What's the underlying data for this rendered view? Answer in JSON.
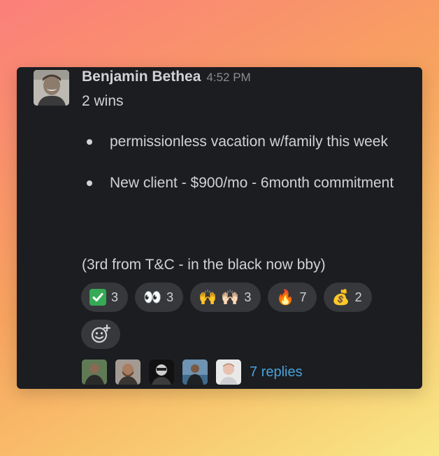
{
  "message": {
    "author": "Benjamin Bethea",
    "timestamp": "4:52 PM",
    "intro": "2 wins",
    "bullets": [
      "permissionless vacation w/family this week",
      "New client - $900/mo - 6month commitment"
    ],
    "closing": "(3rd from T&C - in the black now bby)"
  },
  "reactions": [
    {
      "emoji": "white-check-mark",
      "count": "3"
    },
    {
      "emoji": "👀",
      "count": "3"
    },
    {
      "emoji": "🙌 🙌🏻",
      "count": "3"
    },
    {
      "emoji": "🔥",
      "count": "7"
    },
    {
      "emoji": "💰",
      "count": "2"
    }
  ],
  "thread": {
    "replies_label": "7 replies"
  },
  "colors": {
    "card_background": "#1b1d21",
    "pill_background": "#36383c",
    "link": "#4aa2d9",
    "text": "#d1d2d3",
    "muted": "#8b8c8e"
  }
}
